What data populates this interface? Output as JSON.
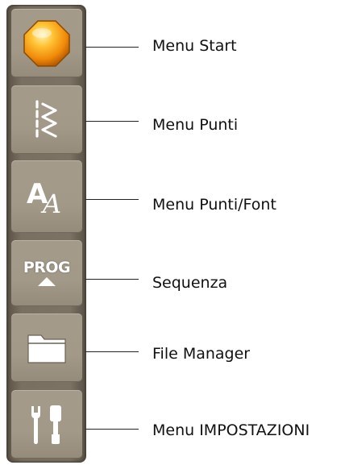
{
  "buttons": [
    {
      "icon": "start-orb-icon",
      "label": "Menu Start"
    },
    {
      "icon": "stitch-zigzag-icon",
      "label": "Menu Punti"
    },
    {
      "icon": "font-letter-icon",
      "label": "Menu Punti/Font"
    },
    {
      "icon": "prog-sequence-icon",
      "label": "Sequenza",
      "button_text": "PROG"
    },
    {
      "icon": "folder-icon",
      "label": "File Manager"
    },
    {
      "icon": "settings-tools-icon",
      "label": "Menu IMPOSTAZIONI"
    }
  ],
  "colors": {
    "toolbar": "#7a7062",
    "button": "#a49a8a",
    "orb": "#f5a21a",
    "icon": "#ffffff",
    "text": "#111111"
  }
}
